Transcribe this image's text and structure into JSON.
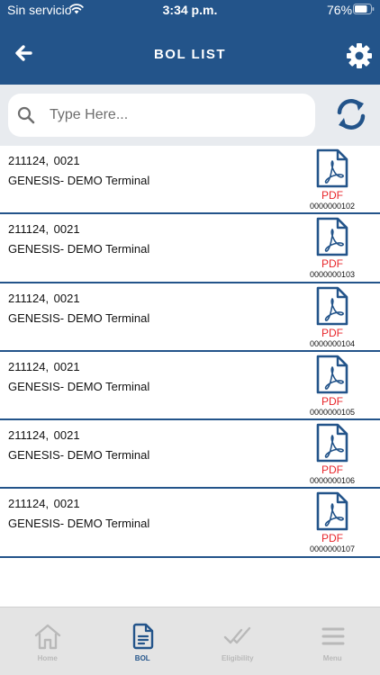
{
  "status_bar": {
    "carrier": "Sin servicio",
    "time": "3:34 p.m.",
    "battery": "76%"
  },
  "header": {
    "title": "BOL LIST",
    "back_icon": "arrow-left-icon",
    "settings_icon": "gear-icon"
  },
  "search": {
    "placeholder": "Type Here...",
    "value": "",
    "refresh_icon": "refresh-icon"
  },
  "bol_items": [
    {
      "id": "211124,  0021",
      "terminal": "GENESIS- DEMO Terminal",
      "pdf_label": "PDF",
      "pdf_number": "0000000102"
    },
    {
      "id": "211124,  0021",
      "terminal": "GENESIS- DEMO Terminal",
      "pdf_label": "PDF",
      "pdf_number": "0000000103"
    },
    {
      "id": "211124,  0021",
      "terminal": "GENESIS- DEMO Terminal",
      "pdf_label": "PDF",
      "pdf_number": "0000000104"
    },
    {
      "id": "211124,  0021",
      "terminal": "GENESIS- DEMO Terminal",
      "pdf_label": "PDF",
      "pdf_number": "0000000105"
    },
    {
      "id": "211124,  0021",
      "terminal": "GENESIS- DEMO Terminal",
      "pdf_label": "PDF",
      "pdf_number": "0000000106"
    },
    {
      "id": "211124,  0021",
      "terminal": "GENESIS- DEMO Terminal",
      "pdf_label": "PDF",
      "pdf_number": "0000000107"
    }
  ],
  "tab_bar": {
    "tabs": [
      {
        "label": "Home",
        "icon": "home-icon",
        "active": false
      },
      {
        "label": "BOL",
        "icon": "document-icon",
        "active": true
      },
      {
        "label": "Eligibility",
        "icon": "double-check-icon",
        "active": false
      },
      {
        "label": "Menu",
        "icon": "hamburger-menu-icon",
        "active": false
      }
    ]
  },
  "colors": {
    "primary": "#23548a",
    "pdf_red": "#e8262b",
    "search_bg": "#e8ebef",
    "tab_bar_bg": "#e4e4e4",
    "tab_inactive": "#b9b9b9"
  }
}
